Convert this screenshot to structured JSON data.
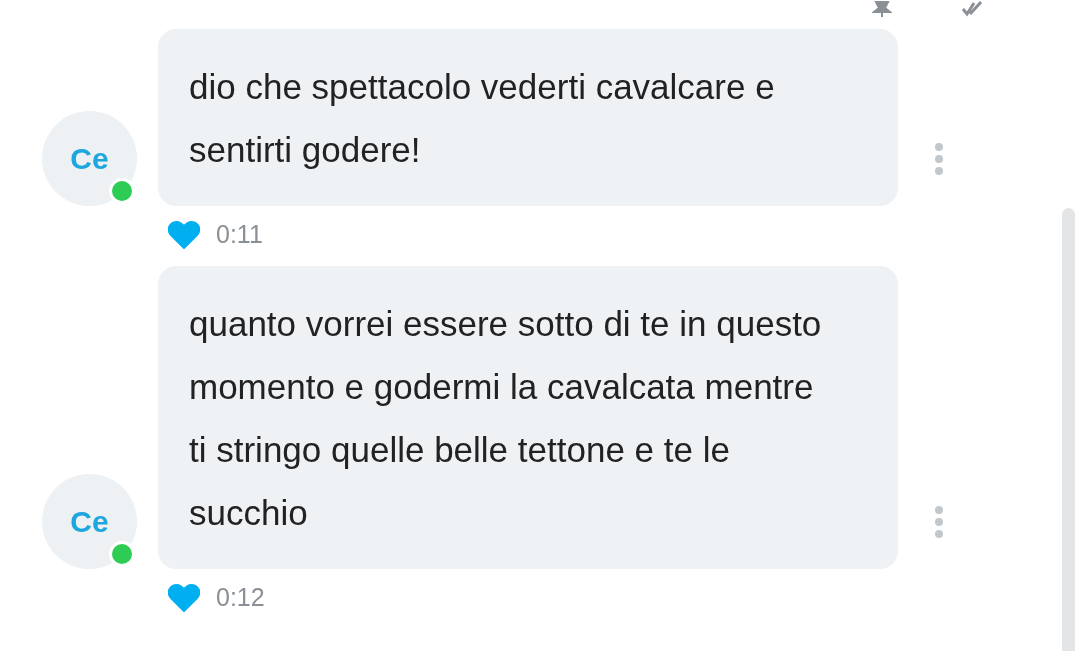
{
  "messages": [
    {
      "avatar": "Ce",
      "online": true,
      "text": "dio che spettacolo vederti cavalcare e sentirti godere!",
      "liked": true,
      "time": "0:11"
    },
    {
      "avatar": "Ce",
      "online": true,
      "text": "quanto vorrei essere sotto di te in questo momento e godermi la cavalcata mentre ti stringo quelle belle tettone e te le succhio",
      "liked": true,
      "time": "0:12"
    }
  ]
}
